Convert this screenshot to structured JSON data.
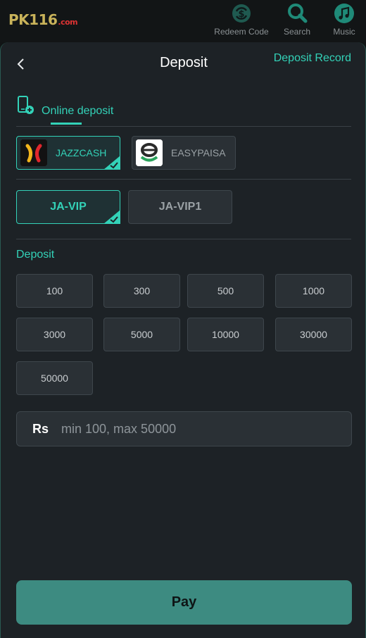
{
  "header": {
    "logo_text": "PK116",
    "logo_suffix": ".com",
    "nav": [
      {
        "label": "Redeem Code",
        "icon": "redeem-icon"
      },
      {
        "label": "Search",
        "icon": "search-icon"
      },
      {
        "label": "Music",
        "icon": "music-icon"
      }
    ]
  },
  "page": {
    "title": "Deposit",
    "record_link": "Deposit Record"
  },
  "tabs": [
    {
      "label": "Online deposit",
      "icon": "mobile-deposit-icon",
      "active": true
    }
  ],
  "payment_methods": [
    {
      "label": "JAZZCASH",
      "icon": "jazzcash-logo-icon",
      "selected": true
    },
    {
      "label": "EASYPAISA",
      "icon": "easypaisa-logo-icon",
      "selected": false
    }
  ],
  "channels": [
    {
      "label": "JA-VIP",
      "selected": true
    },
    {
      "label": "JA-VIP1",
      "selected": false
    }
  ],
  "deposit": {
    "label": "Deposit",
    "amounts": [
      "100",
      "300",
      "500",
      "1000",
      "3000",
      "5000",
      "10000",
      "30000",
      "50000"
    ],
    "currency_symbol": "Rs",
    "placeholder": "min 100, max 50000",
    "value": ""
  },
  "pay_button": {
    "label": "Pay"
  },
  "colors": {
    "accent": "#33d2b8",
    "panel": "#1d2226",
    "button_bg": "#2a3035",
    "pay": "#3d8b81"
  }
}
